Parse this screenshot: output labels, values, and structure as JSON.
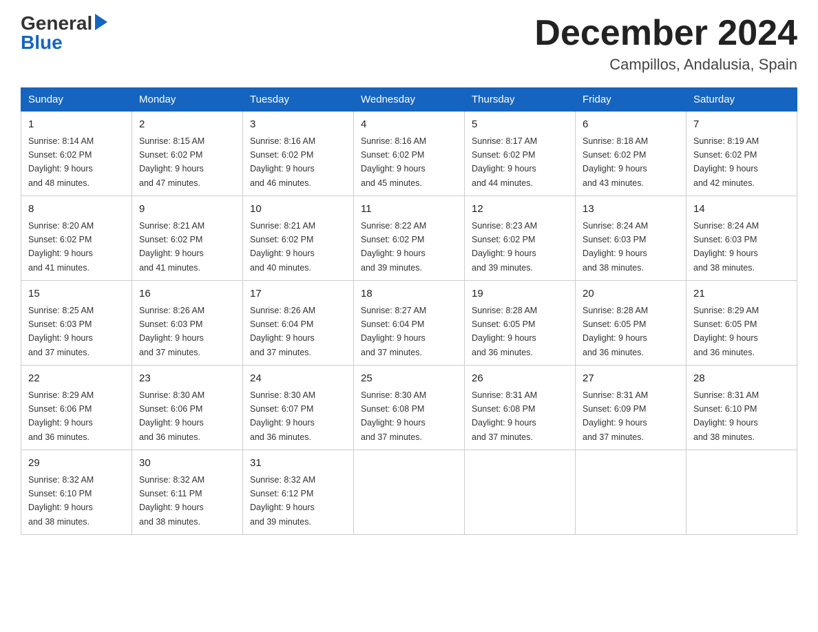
{
  "header": {
    "logo_general": "General",
    "logo_blue": "Blue",
    "month_title": "December 2024",
    "location": "Campillos, Andalusia, Spain"
  },
  "weekdays": [
    "Sunday",
    "Monday",
    "Tuesday",
    "Wednesday",
    "Thursday",
    "Friday",
    "Saturday"
  ],
  "weeks": [
    [
      {
        "day": "1",
        "sunrise": "8:14 AM",
        "sunset": "6:02 PM",
        "daylight": "9 hours and 48 minutes."
      },
      {
        "day": "2",
        "sunrise": "8:15 AM",
        "sunset": "6:02 PM",
        "daylight": "9 hours and 47 minutes."
      },
      {
        "day": "3",
        "sunrise": "8:16 AM",
        "sunset": "6:02 PM",
        "daylight": "9 hours and 46 minutes."
      },
      {
        "day": "4",
        "sunrise": "8:16 AM",
        "sunset": "6:02 PM",
        "daylight": "9 hours and 45 minutes."
      },
      {
        "day": "5",
        "sunrise": "8:17 AM",
        "sunset": "6:02 PM",
        "daylight": "9 hours and 44 minutes."
      },
      {
        "day": "6",
        "sunrise": "8:18 AM",
        "sunset": "6:02 PM",
        "daylight": "9 hours and 43 minutes."
      },
      {
        "day": "7",
        "sunrise": "8:19 AM",
        "sunset": "6:02 PM",
        "daylight": "9 hours and 42 minutes."
      }
    ],
    [
      {
        "day": "8",
        "sunrise": "8:20 AM",
        "sunset": "6:02 PM",
        "daylight": "9 hours and 41 minutes."
      },
      {
        "day": "9",
        "sunrise": "8:21 AM",
        "sunset": "6:02 PM",
        "daylight": "9 hours and 41 minutes."
      },
      {
        "day": "10",
        "sunrise": "8:21 AM",
        "sunset": "6:02 PM",
        "daylight": "9 hours and 40 minutes."
      },
      {
        "day": "11",
        "sunrise": "8:22 AM",
        "sunset": "6:02 PM",
        "daylight": "9 hours and 39 minutes."
      },
      {
        "day": "12",
        "sunrise": "8:23 AM",
        "sunset": "6:02 PM",
        "daylight": "9 hours and 39 minutes."
      },
      {
        "day": "13",
        "sunrise": "8:24 AM",
        "sunset": "6:03 PM",
        "daylight": "9 hours and 38 minutes."
      },
      {
        "day": "14",
        "sunrise": "8:24 AM",
        "sunset": "6:03 PM",
        "daylight": "9 hours and 38 minutes."
      }
    ],
    [
      {
        "day": "15",
        "sunrise": "8:25 AM",
        "sunset": "6:03 PM",
        "daylight": "9 hours and 37 minutes."
      },
      {
        "day": "16",
        "sunrise": "8:26 AM",
        "sunset": "6:03 PM",
        "daylight": "9 hours and 37 minutes."
      },
      {
        "day": "17",
        "sunrise": "8:26 AM",
        "sunset": "6:04 PM",
        "daylight": "9 hours and 37 minutes."
      },
      {
        "day": "18",
        "sunrise": "8:27 AM",
        "sunset": "6:04 PM",
        "daylight": "9 hours and 37 minutes."
      },
      {
        "day": "19",
        "sunrise": "8:28 AM",
        "sunset": "6:05 PM",
        "daylight": "9 hours and 36 minutes."
      },
      {
        "day": "20",
        "sunrise": "8:28 AM",
        "sunset": "6:05 PM",
        "daylight": "9 hours and 36 minutes."
      },
      {
        "day": "21",
        "sunrise": "8:29 AM",
        "sunset": "6:05 PM",
        "daylight": "9 hours and 36 minutes."
      }
    ],
    [
      {
        "day": "22",
        "sunrise": "8:29 AM",
        "sunset": "6:06 PM",
        "daylight": "9 hours and 36 minutes."
      },
      {
        "day": "23",
        "sunrise": "8:30 AM",
        "sunset": "6:06 PM",
        "daylight": "9 hours and 36 minutes."
      },
      {
        "day": "24",
        "sunrise": "8:30 AM",
        "sunset": "6:07 PM",
        "daylight": "9 hours and 36 minutes."
      },
      {
        "day": "25",
        "sunrise": "8:30 AM",
        "sunset": "6:08 PM",
        "daylight": "9 hours and 37 minutes."
      },
      {
        "day": "26",
        "sunrise": "8:31 AM",
        "sunset": "6:08 PM",
        "daylight": "9 hours and 37 minutes."
      },
      {
        "day": "27",
        "sunrise": "8:31 AM",
        "sunset": "6:09 PM",
        "daylight": "9 hours and 37 minutes."
      },
      {
        "day": "28",
        "sunrise": "8:31 AM",
        "sunset": "6:10 PM",
        "daylight": "9 hours and 38 minutes."
      }
    ],
    [
      {
        "day": "29",
        "sunrise": "8:32 AM",
        "sunset": "6:10 PM",
        "daylight": "9 hours and 38 minutes."
      },
      {
        "day": "30",
        "sunrise": "8:32 AM",
        "sunset": "6:11 PM",
        "daylight": "9 hours and 38 minutes."
      },
      {
        "day": "31",
        "sunrise": "8:32 AM",
        "sunset": "6:12 PM",
        "daylight": "9 hours and 39 minutes."
      },
      null,
      null,
      null,
      null
    ]
  ],
  "labels": {
    "sunrise": "Sunrise:",
    "sunset": "Sunset:",
    "daylight": "Daylight:"
  }
}
